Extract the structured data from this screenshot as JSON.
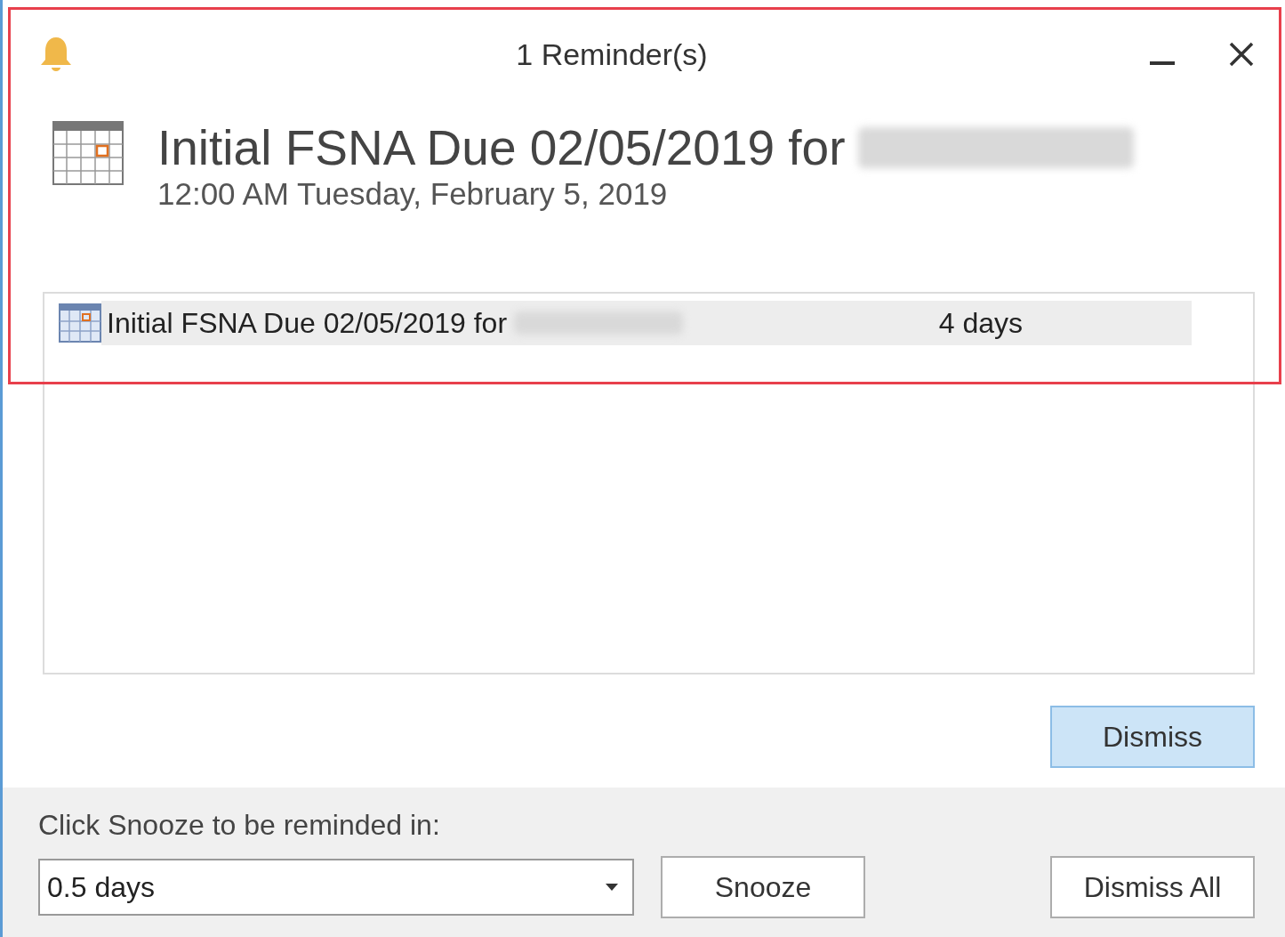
{
  "window": {
    "title": "1 Reminder(s)"
  },
  "reminder": {
    "subject": "Initial FSNA Due 02/05/2019 for",
    "time": "12:00 AM Tuesday, February 5, 2019"
  },
  "reminders_list": [
    {
      "subject": "Initial FSNA Due 02/05/2019 for",
      "due_in": "4 days",
      "selected": true
    }
  ],
  "dismiss_button": "Dismiss",
  "snooze": {
    "label": "Click Snooze to be reminded in:",
    "value": "0.5 days",
    "button": "Snooze"
  },
  "dismiss_all_button": "Dismiss All"
}
